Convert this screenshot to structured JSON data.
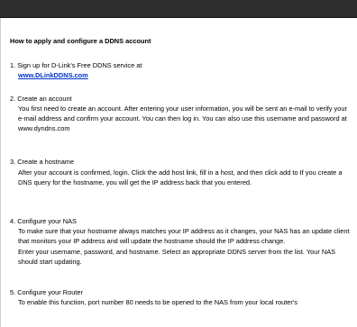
{
  "title": "How to apply and configure a DDNS account",
  "steps": [
    {
      "heading": "1. Sign up for D-Link's Free DDNS service at",
      "link": "www.DLinkDDNS.com"
    },
    {
      "heading": "2. Create an account",
      "body": "You first need to create an account. After entering your user information, you will be sent an e-mail to verify your e-mail address and confirm your account. You can then log in. You can also use this username and password at www.dyndns.com"
    },
    {
      "heading": "3. Create a hostname",
      "body": "After your account is confirmed, login. Click the add host link, fill in a host, and then click add to If you create a DNS query for the hostname, you will get the IP address back that you entered."
    },
    {
      "heading": "4. Configure your NAS",
      "body": "To make sure that your hostname always matches your IP address as it changes, your NAS has an update client that monitors your IP address and will update the hostname should the IP address change.",
      "body2": "Enter your username, password, and hostname. Select an appropriate DDNS server from the list. Your NAS should start updating."
    },
    {
      "heading": "5. Configure your Router",
      "body": "To enable this function, port number 80 needs to be opened to the NAS from your local router's"
    }
  ]
}
